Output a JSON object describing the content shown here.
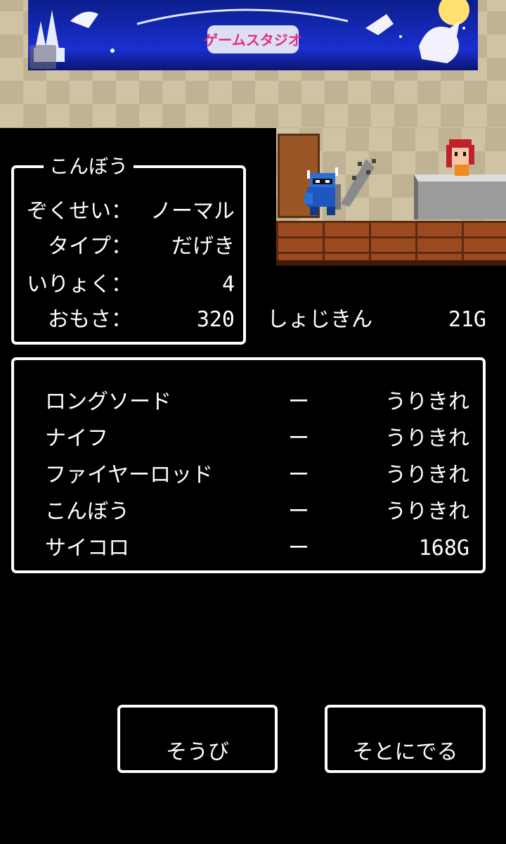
{
  "ad": {
    "logo_text": "ゲームスタジオ"
  },
  "status": {
    "title": "こんぼう",
    "rows": [
      {
        "label": "ぞくせい：",
        "value": "ノーマル"
      },
      {
        "label": "タイプ：",
        "value": "だげき"
      },
      {
        "label": "いりょく：",
        "value": "4"
      },
      {
        "label": "おもさ：",
        "value": "320"
      }
    ]
  },
  "gold": {
    "label": "しょじきん",
    "value": "21G"
  },
  "items": [
    {
      "name": "ロングソード",
      "dash": "ー",
      "price": "うりきれ"
    },
    {
      "name": "ナイフ",
      "dash": "ー",
      "price": "うりきれ"
    },
    {
      "name": "ファイヤーロッド",
      "dash": "ー",
      "price": "うりきれ"
    },
    {
      "name": "こんぼう",
      "dash": "ー",
      "price": "うりきれ"
    },
    {
      "name": "サイコロ",
      "dash": "ー",
      "price": "168G"
    }
  ],
  "buttons": {
    "equip": "そうび",
    "leave": "そとにでる"
  },
  "colors": {
    "background": "#000000",
    "window_border": "#ffffff",
    "wall": "#cfc3a4",
    "floor": "#9b4a20",
    "ad_background": "#1a2fd0"
  }
}
